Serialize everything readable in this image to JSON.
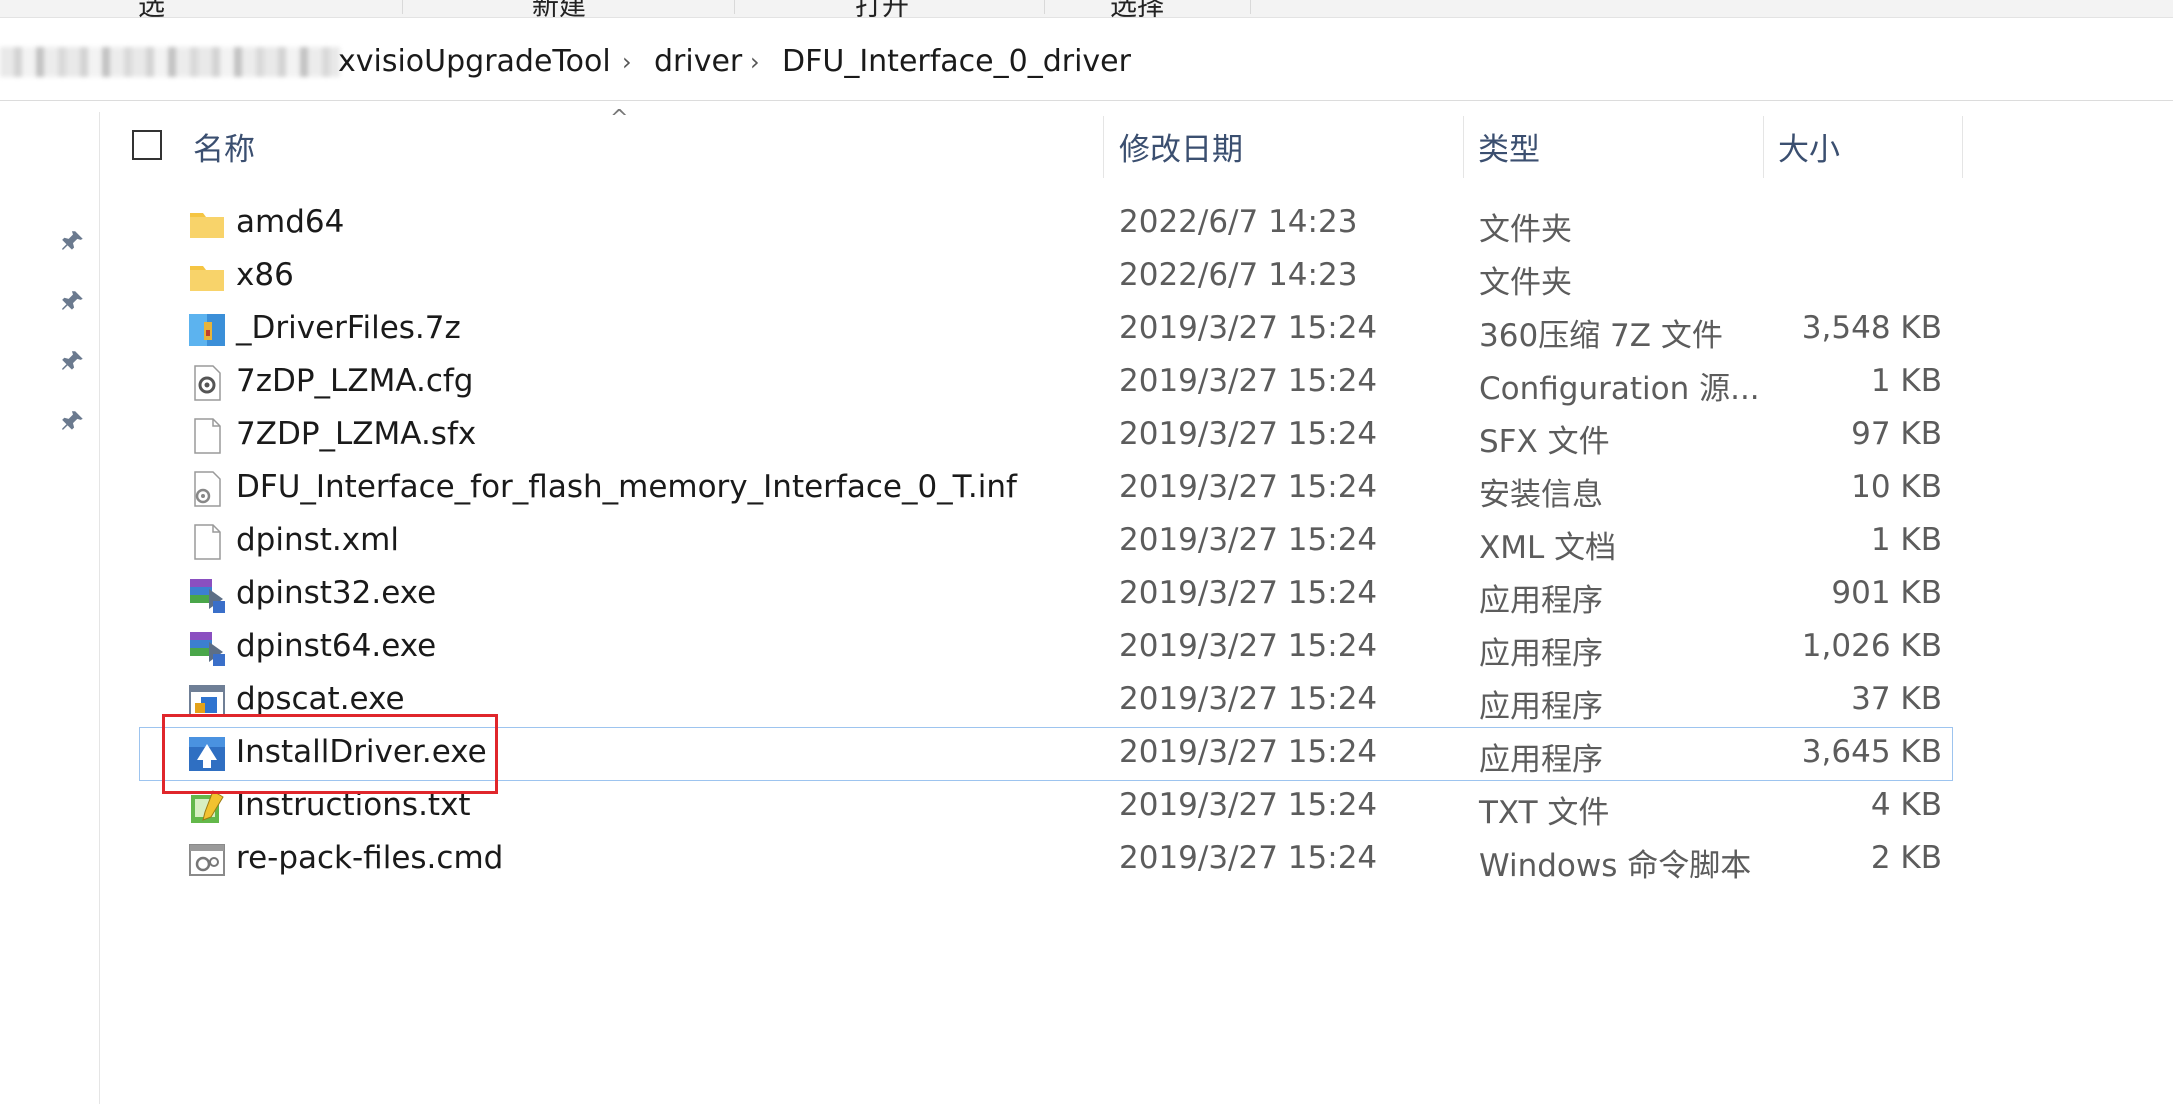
{
  "ribbon": {
    "labels": [
      "选",
      "新建",
      "打开",
      "选择"
    ]
  },
  "address": {
    "crumbs": [
      "xvisioUpgradeTool",
      "driver",
      "DFU_Interface_0_driver"
    ]
  },
  "columns": {
    "name": "名称",
    "date": "修改日期",
    "type": "类型",
    "size": "大小"
  },
  "files": [
    {
      "name": "amd64",
      "date": "2022/6/7 14:23",
      "type": "文件夹",
      "size": "",
      "icon": "folder-icon"
    },
    {
      "name": "x86",
      "date": "2022/6/7 14:23",
      "type": "文件夹",
      "size": "",
      "icon": "folder-icon"
    },
    {
      "name": "_DriverFiles.7z",
      "date": "2019/3/27 15:24",
      "type": "360压缩 7Z 文件",
      "size": "3,548 KB",
      "icon": "archive-icon"
    },
    {
      "name": "7zDP_LZMA.cfg",
      "date": "2019/3/27 15:24",
      "type": "Configuration 源...",
      "size": "1 KB",
      "icon": "config-file-icon"
    },
    {
      "name": "7ZDP_LZMA.sfx",
      "date": "2019/3/27 15:24",
      "type": "SFX 文件",
      "size": "97 KB",
      "icon": "blank-file-icon"
    },
    {
      "name": "DFU_Interface_for_flash_memory_Interface_0_T.inf",
      "date": "2019/3/27 15:24",
      "type": "安装信息",
      "size": "10 KB",
      "icon": "setup-info-icon"
    },
    {
      "name": "dpinst.xml",
      "date": "2019/3/27 15:24",
      "type": "XML 文档",
      "size": "1 KB",
      "icon": "blank-file-icon"
    },
    {
      "name": "dpinst32.exe",
      "date": "2019/3/27 15:24",
      "type": "应用程序",
      "size": "901 KB",
      "icon": "installer-exe-icon"
    },
    {
      "name": "dpinst64.exe",
      "date": "2019/3/27 15:24",
      "type": "应用程序",
      "size": "1,026 KB",
      "icon": "installer-exe-icon"
    },
    {
      "name": "dpscat.exe",
      "date": "2019/3/27 15:24",
      "type": "应用程序",
      "size": "37 KB",
      "icon": "app-window-icon"
    },
    {
      "name": "InstallDriver.exe",
      "date": "2019/3/27 15:24",
      "type": "应用程序",
      "size": "3,645 KB",
      "icon": "install-driver-icon"
    },
    {
      "name": "Instructions.txt",
      "date": "2019/3/27 15:24",
      "type": "TXT 文件",
      "size": "4 KB",
      "icon": "notepad-icon"
    },
    {
      "name": "re-pack-files.cmd",
      "date": "2019/3/27 15:24",
      "type": "Windows 命令脚本",
      "size": "2 KB",
      "icon": "cmd-script-icon"
    }
  ],
  "selected_file": "InstallDriver.exe",
  "colors": {
    "header_text": "#3b4f70",
    "highlight": "#e0262b",
    "selection": "#9dc4ef",
    "folder": "#f5c543"
  }
}
